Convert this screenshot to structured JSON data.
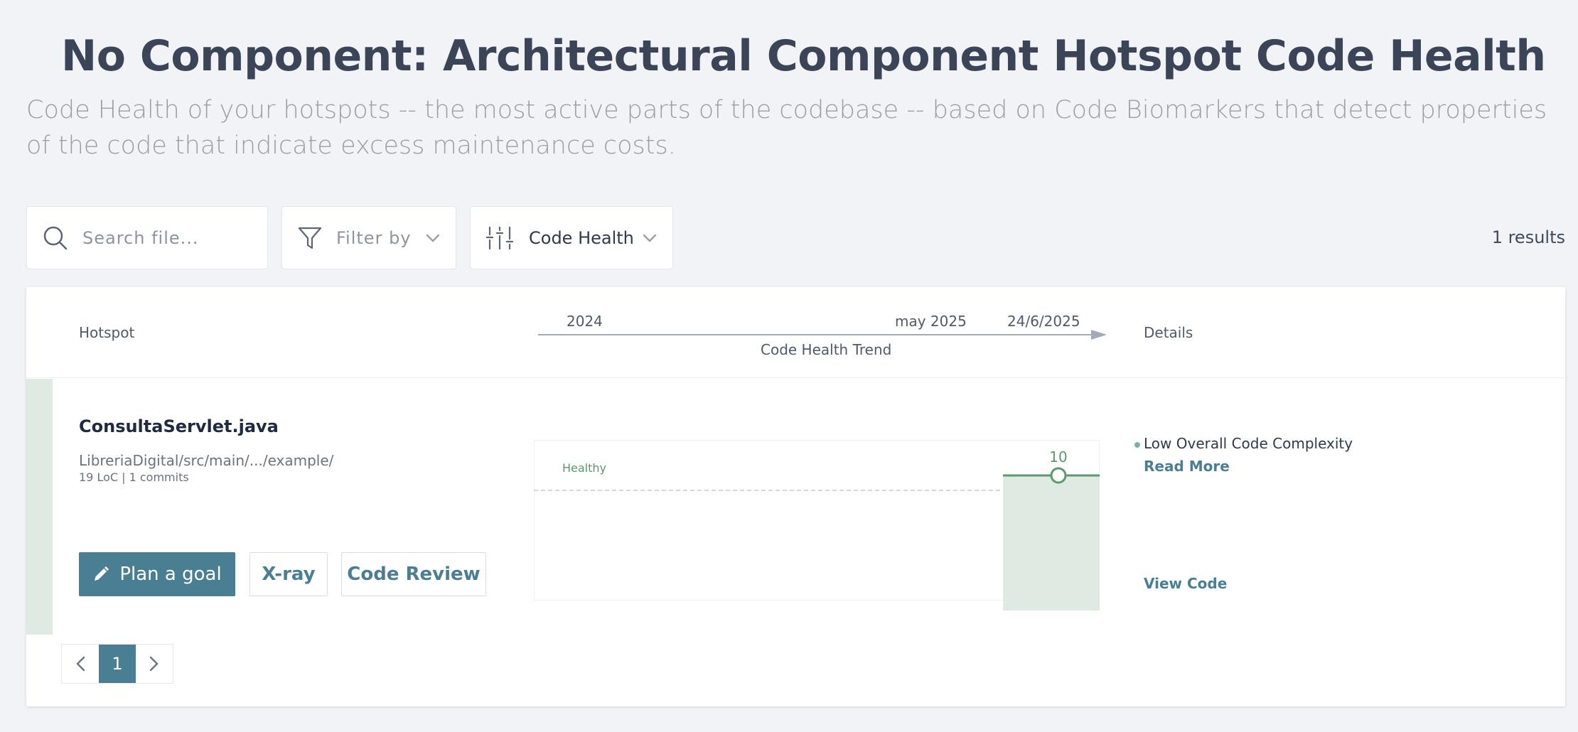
{
  "page": {
    "title": "No Component: Architectural Component Hotspot Code Health",
    "description": "Code Health of your hotspots -- the most active parts of the codebase -- based on Code Biomarkers that detect properties of the code that indicate excess maintenance costs."
  },
  "toolbar": {
    "search_placeholder": "Search file...",
    "filter_label": "Filter by",
    "sort_label": "Code Health",
    "results": "1 results"
  },
  "table": {
    "headers": {
      "hotspot": "Hotspot",
      "trend": "Code Health Trend",
      "details": "Details"
    },
    "trend_ticks": [
      "2024",
      "may 2025",
      "24/6/2025"
    ]
  },
  "rows": [
    {
      "file_name": "ConsultaServlet.java",
      "path": "LibreriaDigital/src/main/.../example/",
      "meta": "19 LoC | 1 commits",
      "actions": {
        "plan_goal": "Plan a goal",
        "xray": "X-ray",
        "code_review": "Code Review"
      },
      "trend": {
        "healthy_label": "Healthy",
        "current_value": "10"
      },
      "details": {
        "biomarker": "Low Overall Code Complexity",
        "read_more": "Read More",
        "view_code": "View Code"
      }
    }
  ],
  "pagination": {
    "current_page": "1"
  },
  "colors": {
    "accent": "#4a7f93",
    "healthy_green": "#5a9a6e",
    "healthy_fill": "#dfeae3"
  }
}
